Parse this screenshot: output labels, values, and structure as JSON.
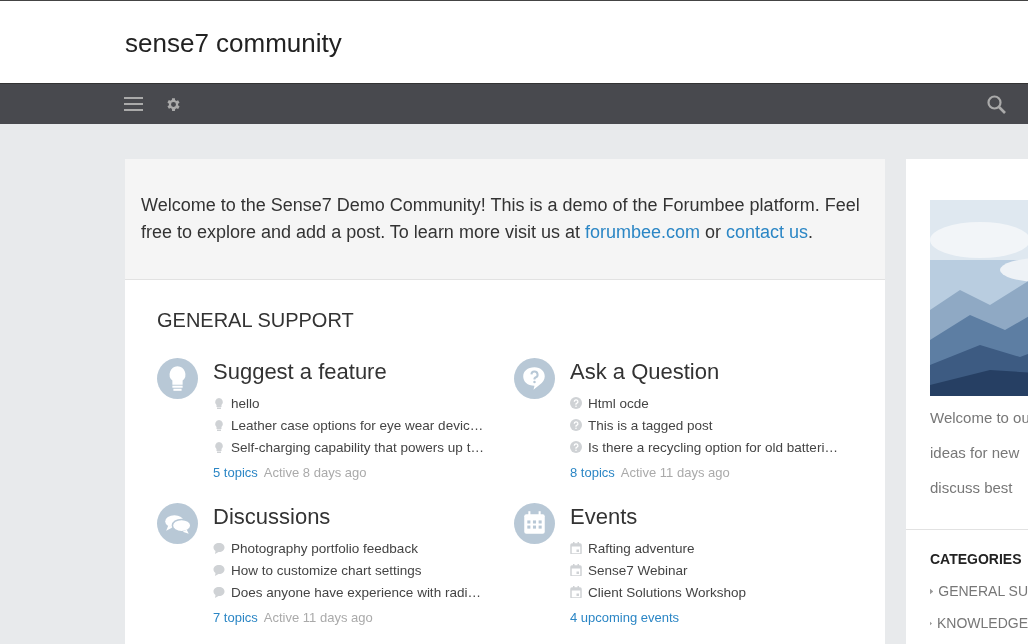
{
  "site": {
    "title": "sense7 community"
  },
  "welcome": {
    "text": "Welcome to the Sense7 Demo Community! This is a demo of the Forumbee platform. Feel free to explore and add a post. To learn more visit us at ",
    "links": [
      "forumbee.com",
      "contact us"
    ],
    "joiner": " or ",
    "end": "."
  },
  "section": {
    "title": "GENERAL SUPPORT"
  },
  "categories": [
    {
      "kind": "feature",
      "title": "Suggest a feature",
      "posts": [
        "hello",
        "Leather case options for eye wear devic…",
        "Self-charging capability that powers up t…"
      ],
      "count": "5 topics",
      "activity": "Active 8 days ago"
    },
    {
      "kind": "question",
      "title": "Ask a Question",
      "posts": [
        "Html ocde",
        "This is a tagged post",
        "Is there a recycling option for old batteri…"
      ],
      "count": "8 topics",
      "activity": "Active 11 days ago"
    },
    {
      "kind": "discussion",
      "title": "Discussions",
      "posts": [
        "Photography portfolio feedback",
        "How to customize chart settings",
        "Does anyone have experience with radi…"
      ],
      "count": "7 topics",
      "activity": "Active 11 days ago"
    },
    {
      "kind": "event",
      "title": "Events",
      "posts": [
        "Rafting adventure",
        "Sense7 Webinar",
        "Client Solutions Workshop"
      ],
      "count": "4 upcoming events"
    }
  ],
  "sidebar": {
    "intro_lines": [
      "Welcome to ou",
      "ideas for new",
      "discuss best"
    ],
    "categories_title": "CATEGORIES",
    "categories": [
      "GENERAL SU",
      "KNOWLEDGE"
    ]
  }
}
